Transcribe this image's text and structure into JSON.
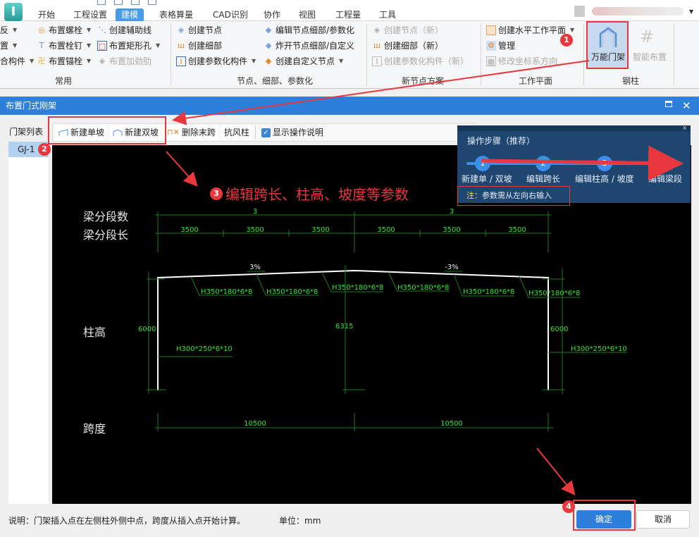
{
  "app": {
    "logo": "I",
    "tabs": [
      {
        "label": "开始",
        "active": false
      },
      {
        "label": "工程设置",
        "active": false
      },
      {
        "label": "建模",
        "active": true
      },
      {
        "label": "表格算量",
        "active": false
      },
      {
        "label": "CAD识别",
        "active": false
      },
      {
        "label": "协作",
        "active": false
      },
      {
        "label": "视图",
        "active": false
      },
      {
        "label": "工程量",
        "active": false
      },
      {
        "label": "工具",
        "active": false
      }
    ]
  },
  "ribbon": {
    "partial_left": [
      "反",
      "置",
      "合构件"
    ],
    "common": {
      "items": [
        {
          "label": "布置螺栓",
          "icon": "bolt-icon",
          "dropdown": true
        },
        {
          "label": "布置栓钉",
          "icon": "stud-icon",
          "dropdown": true
        },
        {
          "label": "布置锚栓",
          "icon": "anchor-bolt-icon",
          "dropdown": true
        },
        {
          "label": "创建辅助线",
          "icon": "aux-line-icon",
          "dropdown": false
        },
        {
          "label": "布置矩形孔",
          "icon": "rect-hole-icon",
          "dropdown": true
        },
        {
          "label": "布置加劲肋",
          "icon": "stiffener-icon",
          "dropdown": false,
          "disabled": true
        }
      ],
      "label": "常用"
    },
    "nodes": {
      "items": [
        {
          "label": "创建节点",
          "icon": "node-icon"
        },
        {
          "label": "创建细部",
          "icon": "detail-icon"
        },
        {
          "label": "创建参数化构件",
          "icon": "param-component-icon",
          "dropdown": true
        },
        {
          "label": "编辑节点细部/参数化",
          "icon": "edit-node-icon"
        },
        {
          "label": "炸开节点细部/自定义",
          "icon": "explode-node-icon"
        },
        {
          "label": "创建自定义节点",
          "icon": "custom-node-icon",
          "dropdown": true
        }
      ],
      "label": "节点、细部、参数化"
    },
    "new_nodes": {
      "items": [
        {
          "label": "创建节点（新）",
          "disabled": true
        },
        {
          "label": "创建细部（新）",
          "disabled": false
        },
        {
          "label": "创建参数化构件（新）",
          "disabled": true
        }
      ],
      "label": "新节点方案"
    },
    "workplane": {
      "items": [
        {
          "label": "创建水平工作平面",
          "dropdown": true,
          "disabled": false
        },
        {
          "label": "管理",
          "disabled": false
        },
        {
          "label": "修改坐标系方向",
          "disabled": true
        }
      ],
      "label": "工作平面"
    },
    "steel_column": {
      "wanneng": "万能门架",
      "zhineng": "智能布置",
      "label": "钢柱"
    }
  },
  "dialog": {
    "title": "布置门式刚架",
    "list_header": "门架列表",
    "list_items": [
      "GJ-1"
    ],
    "toolbar": {
      "new_single": "新建单坡",
      "new_double": "新建双坡",
      "delete_last": "删除末跨",
      "wind_column": "抗风柱",
      "show_help": "显示操作说明",
      "show_help_checked": true
    },
    "steps": {
      "title": "操作步骤（推荐）",
      "items": [
        {
          "num": "1",
          "label": "新建单 / 双坡"
        },
        {
          "num": "2",
          "label": "编辑跨长"
        },
        {
          "num": "3",
          "label": "编辑柱高 / 坡度"
        },
        {
          "num": "4",
          "label": "编辑梁段"
        }
      ],
      "note_prefix": "注：",
      "note": "参数需从左向右输入",
      "close": "x"
    },
    "drawing": {
      "row_labels": {
        "segments": "梁分段数",
        "segment_len": "梁分段长",
        "col_height": "柱高",
        "span": "跨度"
      },
      "segment_counts": [
        "3",
        "3"
      ],
      "segment_lengths": [
        "3500",
        "3500",
        "3500",
        "3500",
        "3500",
        "3500"
      ],
      "slopes": [
        "3%",
        "-3%"
      ],
      "beam_sections": [
        "H350*180*6*8",
        "H350*180*6*8",
        "H350*180*6*8",
        "H350*180*6*8",
        "H350*180*6*8",
        "H350*180*6*8"
      ],
      "col_heights": {
        "left": "6000",
        "mid": "6315",
        "right": "6000"
      },
      "col_sections": {
        "left": "H300*250*6*10",
        "right": "H300*250*6*10"
      },
      "spans": [
        "10500",
        "10500"
      ]
    },
    "footer": {
      "note": "说明：门架插入点在左侧柱外侧中点，跨度从插入点开始计算。",
      "unit": "单位：mm",
      "ok": "确定",
      "cancel": "取消"
    }
  },
  "annotations": {
    "badges": [
      "1",
      "2",
      "3",
      "4"
    ],
    "step3_text": "编辑跨长、柱高、坡度等参数",
    "color": "#e8383d"
  }
}
